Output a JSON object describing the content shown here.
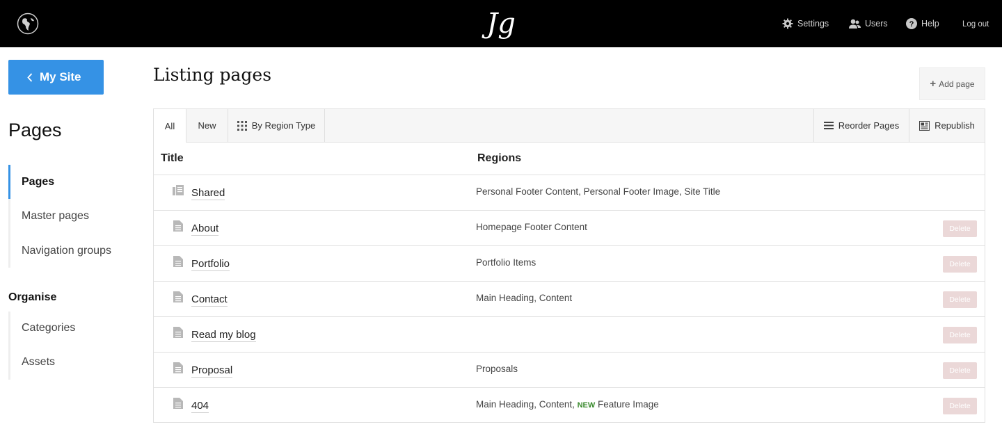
{
  "topbar": {
    "brand": "Jg",
    "nav": {
      "settings": "Settings",
      "users": "Users",
      "help": "Help",
      "logout": "Log out"
    }
  },
  "sidebar": {
    "back_label": "My Site",
    "section_title": "Pages",
    "items": [
      "Pages",
      "Master pages",
      "Navigation groups"
    ],
    "organise_title": "Organise",
    "organise_items": [
      "Categories",
      "Assets"
    ]
  },
  "main": {
    "title": "Listing pages",
    "add_page_label": "Add page",
    "tabs": [
      "All",
      "New",
      "By Region Type"
    ],
    "actions": [
      "Reorder Pages",
      "Republish"
    ],
    "columns": [
      "Title",
      "Regions"
    ],
    "delete_label": "Delete",
    "new_tag": "NEW",
    "rows": [
      {
        "title": "Shared",
        "regions": "Personal Footer Content, Personal Footer Image, Site Title",
        "icon": "shared-page-icon"
      },
      {
        "title": "About",
        "regions": "Homepage Footer Content",
        "icon": "page-icon"
      },
      {
        "title": "Portfolio",
        "regions": "Portfolio Items",
        "icon": "page-icon"
      },
      {
        "title": "Contact",
        "regions": "Main Heading, Content",
        "icon": "page-icon"
      },
      {
        "title": "Read my blog",
        "regions": "",
        "icon": "page-icon"
      },
      {
        "title": "Proposal",
        "regions": "Proposals",
        "icon": "page-icon"
      },
      {
        "title": "404",
        "regions_before": "Main Heading, Content, ",
        "regions_after": " Feature Image",
        "icon": "page-icon"
      }
    ]
  },
  "colors": {
    "topbar_bg": "#000000",
    "accent": "#3592e5",
    "delete_bg": "#ebd8d8",
    "new_tag": "#3a8a2e"
  }
}
